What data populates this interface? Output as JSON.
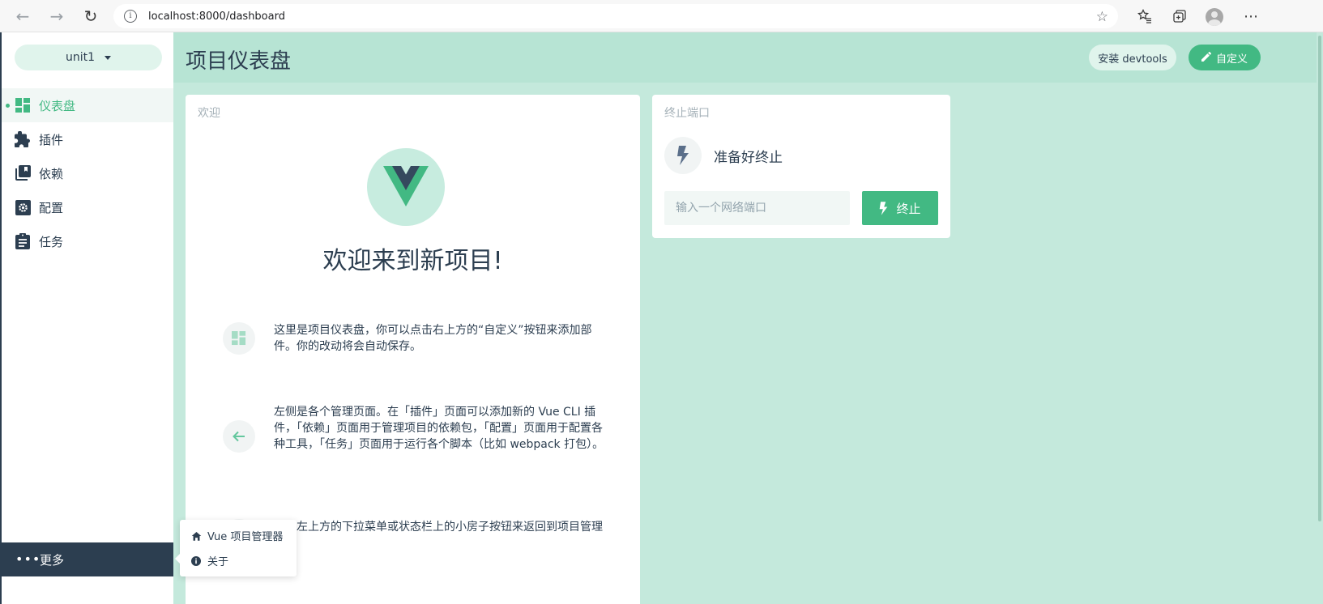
{
  "browser": {
    "url": "localhost:8000/dashboard",
    "info_glyph": "i",
    "back_glyph": "←",
    "forward_glyph": "→",
    "reload_glyph": "↻",
    "more_glyph": "⋯"
  },
  "sidebar": {
    "project_name": "unit1",
    "items": [
      {
        "label": "仪表盘",
        "icon": "dashboard-icon",
        "active": true
      },
      {
        "label": "插件",
        "icon": "puzzle-icon",
        "active": false
      },
      {
        "label": "依赖",
        "icon": "library-icon",
        "active": false
      },
      {
        "label": "配置",
        "icon": "settings-icon",
        "active": false
      },
      {
        "label": "任务",
        "icon": "assignment-icon",
        "active": false
      }
    ],
    "more_label": "更多"
  },
  "header": {
    "title": "项目仪表盘",
    "devtools_label": "安装 devtools",
    "customize_label": "自定义"
  },
  "welcome": {
    "card_title": "欢迎",
    "heading": "欢迎来到新项目!",
    "tips": [
      {
        "icon": "dashboard-icon",
        "text": "这里是项目仪表盘，你可以点击右上方的“自定义”按钮来添加部件。你的改动将会自动保存。"
      },
      {
        "icon": "arrow-back-icon",
        "text": "左侧是各个管理页面。在「插件」页面可以添加新的 Vue CLI 插件，「依赖」页面用于管理项目的依赖包，「配置」页面用于配置各种工具，「任务」页面用于运行各个脚本（比如 webpack 打包）。"
      },
      {
        "icon": "home-icon",
        "text": "点击左上方的下拉菜单或状态栏上的小房子按钮来返回到项目管理器。"
      }
    ]
  },
  "kill_port": {
    "card_title": "终止端口",
    "status": "准备好终止",
    "input_placeholder": "输入一个网络端口",
    "button_label": "终止"
  },
  "more_menu": {
    "items": [
      {
        "label": "Vue 项目管理器",
        "icon": "home-icon"
      },
      {
        "label": "关于",
        "icon": "info-icon"
      }
    ]
  },
  "colors": {
    "accent": "#42b983",
    "dark": "#2c3e50",
    "main_bg": "#c4e9dc",
    "header_bg": "#b7e4d4"
  }
}
